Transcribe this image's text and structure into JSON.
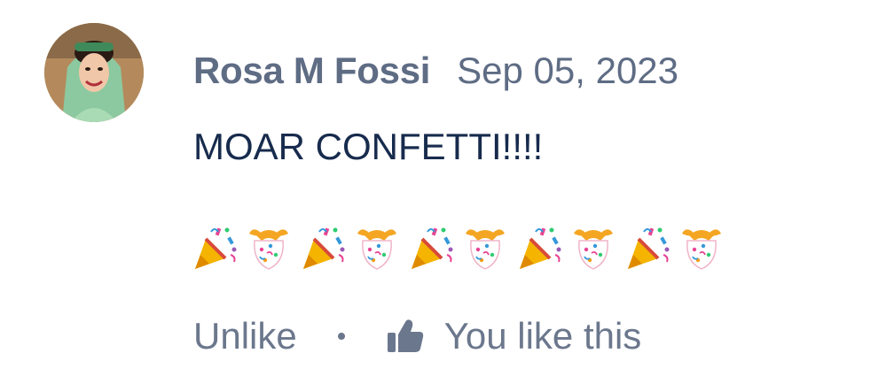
{
  "comment": {
    "author": "Rosa M Fossi",
    "date": "Sep 05, 2023",
    "body": "MOAR CONFETTI!!!!",
    "emojis": [
      "party-popper",
      "confetti-ball",
      "party-popper",
      "confetti-ball",
      "party-popper",
      "confetti-ball",
      "party-popper",
      "confetti-ball",
      "party-popper",
      "confetti-ball"
    ],
    "actions": {
      "unlike_label": "Unlike",
      "like_status": "You like this"
    }
  },
  "colors": {
    "secondary_text": "#5e6c84",
    "primary_text": "#172b4d",
    "action_text": "#6b778c"
  }
}
